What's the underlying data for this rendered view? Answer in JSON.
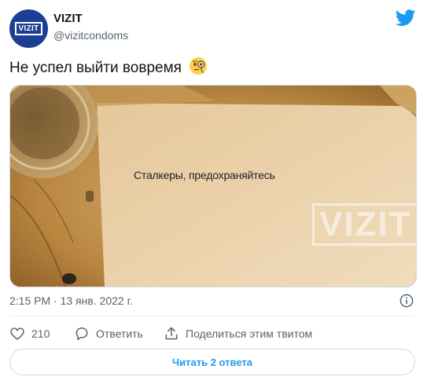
{
  "author": {
    "name": "VIZIT",
    "handle": "@vizitcondoms",
    "avatar_text": "VIZIT"
  },
  "tweet": {
    "text": "Не успел выйти вовремя",
    "emoji": "face-with-monocle",
    "timestamp": "2:15 PM · 13 янв. 2022 г."
  },
  "media": {
    "caption": "Сталкеры, предохраняйтесь",
    "watermark": "VIZIT"
  },
  "actions": {
    "like_count": "210",
    "reply_label": "Ответить",
    "share_label": "Поделиться этим твитом"
  },
  "footer": {
    "read_replies_label": "Читать 2 ответа"
  },
  "colors": {
    "twitter_blue": "#1d9bf0",
    "avatar_bg": "#1c3f94",
    "secondary_text": "#536471"
  }
}
